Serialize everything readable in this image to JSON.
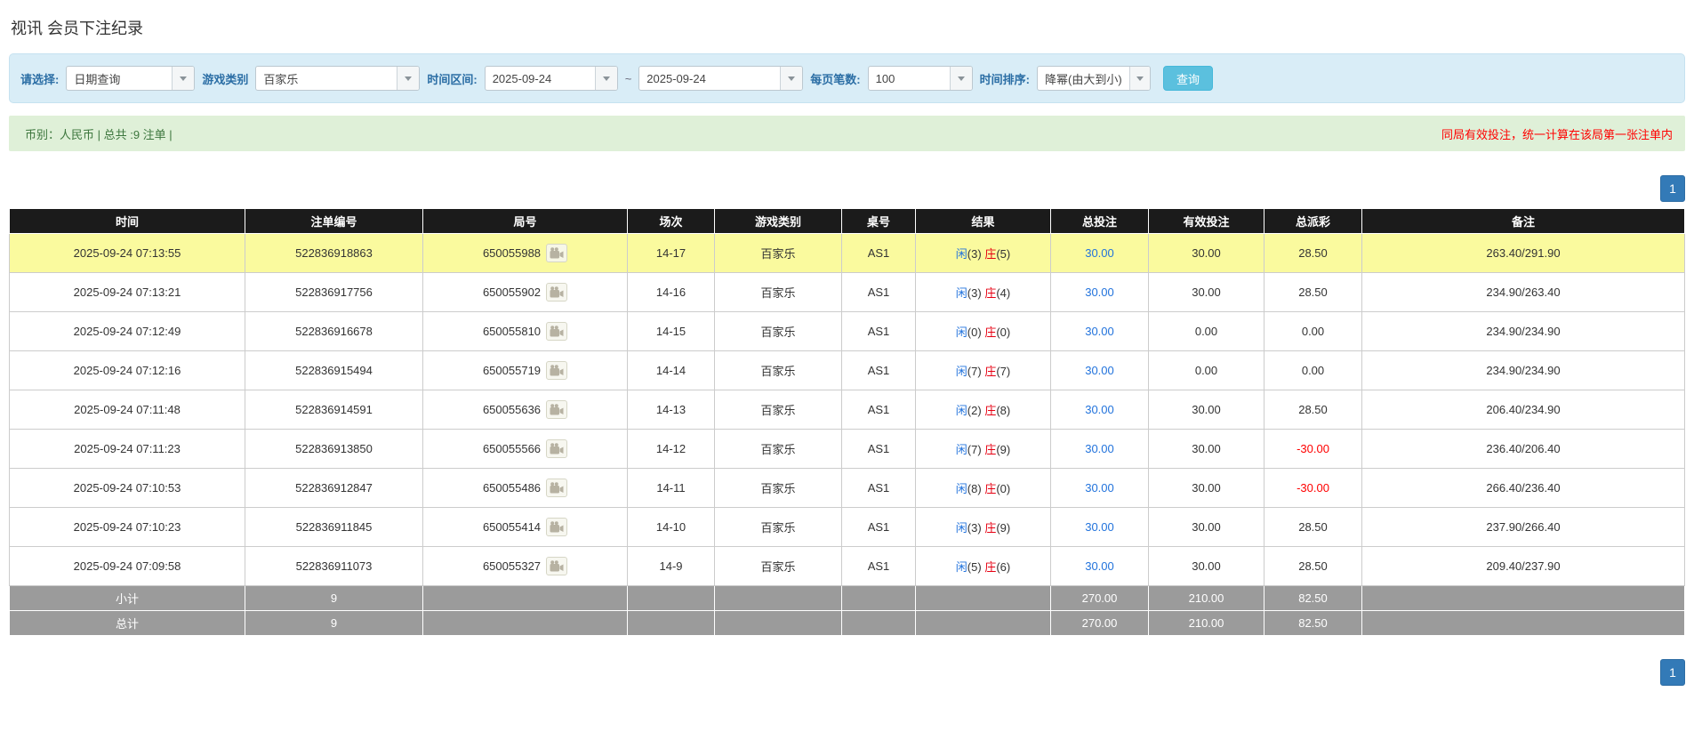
{
  "page_title": "视讯 会员下注纪录",
  "filters": {
    "select_label": "请选择:",
    "select_value": "日期查询",
    "game_type_label": "游戏类别",
    "game_type_value": "百家乐",
    "time_range_label": "时间区间:",
    "date_from": "2025-09-24",
    "tilde": "~",
    "date_to": "2025-09-24",
    "page_size_label": "每页笔数:",
    "page_size_value": "100",
    "sort_label": "时间排序:",
    "sort_value": "降幂(由大到小)",
    "search_button": "查询"
  },
  "summary": {
    "left_text": "币别：人民币 | 总共 :9 注单 |",
    "right_notice": "同局有效投注，统一计算在该局第一张注单内"
  },
  "pagination": {
    "page": "1"
  },
  "icons": {
    "round_icon": "video-camera-icon",
    "combo_icon": "chevron-down-icon"
  },
  "table": {
    "headers": [
      "时间",
      "注单编号",
      "局号",
      "场次",
      "游戏类别",
      "桌号",
      "结果",
      "总投注",
      "有效投注",
      "总派彩",
      "备注"
    ],
    "result_labels": {
      "player": "闲",
      "banker": "庄"
    },
    "rows": [
      {
        "time": "2025-09-24 07:13:55",
        "bet_id": "522836918863",
        "round_id": "650055988",
        "session": "14-17",
        "game": "百家乐",
        "table": "AS1",
        "player_count": "(3)",
        "banker_count": "(5)",
        "total_bet": "30.00",
        "valid_bet": "30.00",
        "payout": "28.50",
        "note": "263.40/291.90",
        "highlight": true
      },
      {
        "time": "2025-09-24 07:13:21",
        "bet_id": "522836917756",
        "round_id": "650055902",
        "session": "14-16",
        "game": "百家乐",
        "table": "AS1",
        "player_count": "(3)",
        "banker_count": "(4)",
        "total_bet": "30.00",
        "valid_bet": "30.00",
        "payout": "28.50",
        "note": "234.90/263.40",
        "highlight": false
      },
      {
        "time": "2025-09-24 07:12:49",
        "bet_id": "522836916678",
        "round_id": "650055810",
        "session": "14-15",
        "game": "百家乐",
        "table": "AS1",
        "player_count": "(0)",
        "banker_count": "(0)",
        "total_bet": "30.00",
        "valid_bet": "0.00",
        "payout": "0.00",
        "note": "234.90/234.90",
        "highlight": false
      },
      {
        "time": "2025-09-24 07:12:16",
        "bet_id": "522836915494",
        "round_id": "650055719",
        "session": "14-14",
        "game": "百家乐",
        "table": "AS1",
        "player_count": "(7)",
        "banker_count": "(7)",
        "total_bet": "30.00",
        "valid_bet": "0.00",
        "payout": "0.00",
        "note": "234.90/234.90",
        "highlight": false
      },
      {
        "time": "2025-09-24 07:11:48",
        "bet_id": "522836914591",
        "round_id": "650055636",
        "session": "14-13",
        "game": "百家乐",
        "table": "AS1",
        "player_count": "(2)",
        "banker_count": "(8)",
        "total_bet": "30.00",
        "valid_bet": "30.00",
        "payout": "28.50",
        "note": "206.40/234.90",
        "highlight": false
      },
      {
        "time": "2025-09-24 07:11:23",
        "bet_id": "522836913850",
        "round_id": "650055566",
        "session": "14-12",
        "game": "百家乐",
        "table": "AS1",
        "player_count": "(7)",
        "banker_count": "(9)",
        "total_bet": "30.00",
        "valid_bet": "30.00",
        "payout": "-30.00",
        "note": "236.40/206.40",
        "highlight": false
      },
      {
        "time": "2025-09-24 07:10:53",
        "bet_id": "522836912847",
        "round_id": "650055486",
        "session": "14-11",
        "game": "百家乐",
        "table": "AS1",
        "player_count": "(8)",
        "banker_count": "(0)",
        "total_bet": "30.00",
        "valid_bet": "30.00",
        "payout": "-30.00",
        "note": "266.40/236.40",
        "highlight": false
      },
      {
        "time": "2025-09-24 07:10:23",
        "bet_id": "522836911845",
        "round_id": "650055414",
        "session": "14-10",
        "game": "百家乐",
        "table": "AS1",
        "player_count": "(3)",
        "banker_count": "(9)",
        "total_bet": "30.00",
        "valid_bet": "30.00",
        "payout": "28.50",
        "note": "237.90/266.40",
        "highlight": false
      },
      {
        "time": "2025-09-24 07:09:58",
        "bet_id": "522836911073",
        "round_id": "650055327",
        "session": "14-9",
        "game": "百家乐",
        "table": "AS1",
        "player_count": "(5)",
        "banker_count": "(6)",
        "total_bet": "30.00",
        "valid_bet": "30.00",
        "payout": "28.50",
        "note": "209.40/237.90",
        "highlight": false
      }
    ],
    "totals": [
      {
        "label": "小计",
        "count": "9",
        "total_bet": "270.00",
        "valid_bet": "210.00",
        "payout": "82.50"
      },
      {
        "label": "总计",
        "count": "9",
        "total_bet": "270.00",
        "valid_bet": "210.00",
        "payout": "82.50"
      }
    ]
  },
  "colors": {
    "accent": "#337ab7",
    "btn_bg": "#5bc0de",
    "filter_bg": "#d9edf7",
    "summary_bg": "#dff0d8",
    "summary_text": "#3c763d",
    "notice_red": "#ff0000",
    "link_blue": "#2273dc",
    "banker_red": "#e60012",
    "header_bg": "#1b1b1b",
    "totals_bg": "#9b9b9b",
    "highlight": "#fafa9e"
  }
}
